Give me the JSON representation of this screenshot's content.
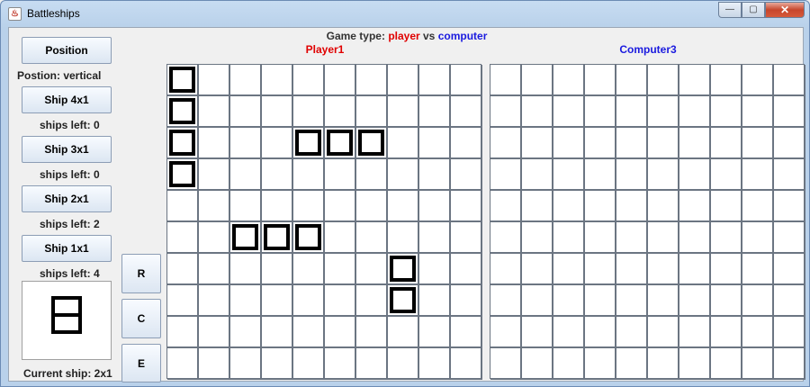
{
  "window": {
    "title": "Battleships",
    "icon": "java-icon"
  },
  "controls": {
    "position_button": "Position",
    "position_status": "Postion: vertical",
    "ships": [
      {
        "button": "Ship 4x1",
        "left": "ships left: 0"
      },
      {
        "button": "Ship 3x1",
        "left": "ships left: 0"
      },
      {
        "button": "Ship 2x1",
        "left": "ships left: 2"
      },
      {
        "button": "Ship 1x1",
        "left": "ships left: 4"
      }
    ],
    "action_buttons": {
      "r": "R",
      "c": "C",
      "e": "E"
    },
    "current_ship": "Current ship: 2x1"
  },
  "header": {
    "prefix": "Game type: ",
    "player": "player",
    "vs": " vs ",
    "opponent": "computer"
  },
  "boards": {
    "player": {
      "title": "Player1",
      "ships": [
        [
          0,
          0
        ],
        [
          1,
          0
        ],
        [
          2,
          0
        ],
        [
          3,
          0
        ],
        [
          2,
          4
        ],
        [
          2,
          5
        ],
        [
          2,
          6
        ],
        [
          5,
          2
        ],
        [
          5,
          3
        ],
        [
          5,
          4
        ],
        [
          6,
          7
        ],
        [
          7,
          7
        ]
      ]
    },
    "computer": {
      "title": "Computer3",
      "ships": []
    }
  },
  "colors": {
    "player": "#e00000",
    "computer": "#1a1adf"
  }
}
